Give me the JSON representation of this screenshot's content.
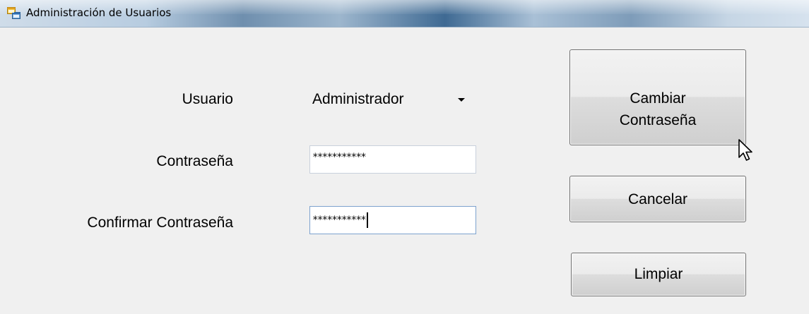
{
  "window": {
    "title": "Administración de Usuarios"
  },
  "form": {
    "user_label": "Usuario",
    "user_value": "Administrador",
    "password_label": "Contraseña",
    "password_value": "***********",
    "confirm_label": "Confirmar Contraseña",
    "confirm_value": "***********"
  },
  "buttons": {
    "change_password_line1": "Cambiar",
    "change_password_line2": "Contraseña",
    "cancel": "Cancelar",
    "clear": "Limpiar"
  },
  "icons": {
    "app": "app-window-icon",
    "combo_arrow": "chevron-down-icon",
    "cursor": "mouse-pointer-icon"
  },
  "colors": {
    "window_bg": "#f0f0f0",
    "focus_border": "#7da2ce",
    "button_border": "#707070"
  }
}
